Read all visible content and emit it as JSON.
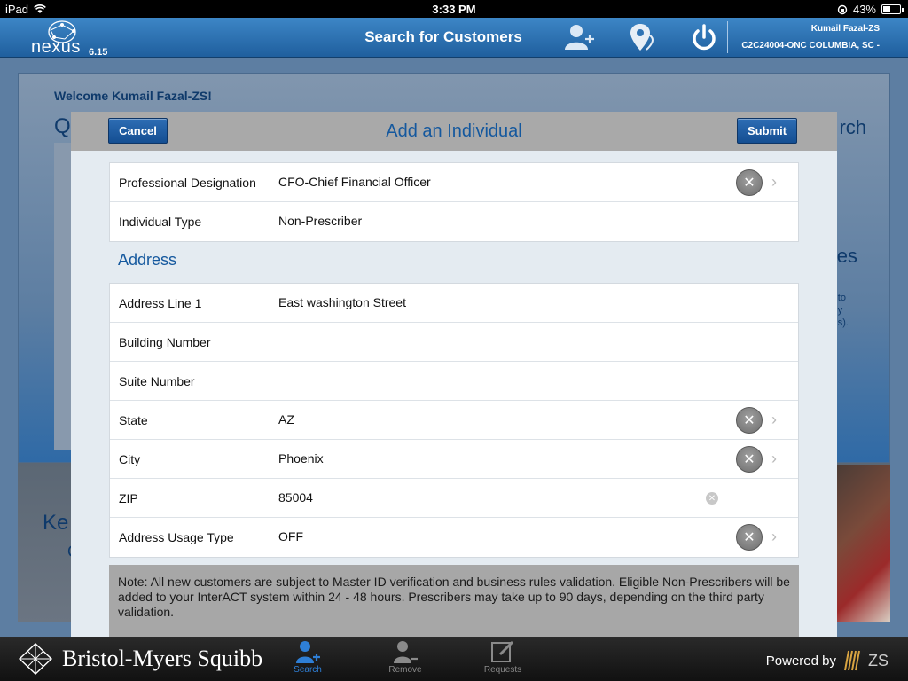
{
  "status_bar": {
    "device": "iPad",
    "time": "3:33 PM",
    "battery": "43%"
  },
  "header": {
    "logo_text": "nexus",
    "version": "6.15",
    "title": "Search for Customers",
    "user_name": "Kumail Fazal-ZS",
    "territory": "C2C24004-ONC COLUMBIA, SC -"
  },
  "background": {
    "welcome": "Welcome Kumail Fazal-ZS!",
    "q": "Q",
    "rch": "rch",
    "es": "es",
    "small_lines": [
      "to",
      "y",
      "s)."
    ],
    "ke": "Ke",
    "c": "C"
  },
  "modal": {
    "cancel_label": "Cancel",
    "title": "Add an Individual",
    "submit_label": "Submit",
    "top_rows": [
      {
        "label": "Professional Designation",
        "value": "CFO-Chief Financial Officer"
      },
      {
        "label": "Individual Type",
        "value": "Non-Prescriber"
      }
    ],
    "address_section_title": "Address",
    "address_rows": [
      {
        "label": "Address Line 1",
        "value": "East washington Street"
      },
      {
        "label": "Building Number",
        "value": ""
      },
      {
        "label": "Suite Number",
        "value": ""
      },
      {
        "label": "State",
        "value": "AZ"
      },
      {
        "label": "City",
        "value": "Phoenix"
      },
      {
        "label": "ZIP",
        "value": "85004"
      },
      {
        "label": "Address Usage Type",
        "value": "OFF"
      }
    ],
    "note": "Note: All new customers are subject to Master ID verification and business rules validation. Eligible Non-Prescribers will be added to your InterACT system within 24 - 48 hours. Prescribers may take up to 90 days, depending on the third party validation."
  },
  "tabbar": {
    "brand": "Bristol-Myers Squibb",
    "tabs": [
      {
        "label": "Search",
        "active": true
      },
      {
        "label": "Remove",
        "active": false
      },
      {
        "label": "Requests",
        "active": false
      }
    ],
    "powered_by": "Powered by",
    "zs": "ZS"
  },
  "colors": {
    "accent": "#14589e",
    "header_blue": "#2f73b4",
    "active_tab": "#2e7fd6"
  },
  "battery_level": 0.43
}
